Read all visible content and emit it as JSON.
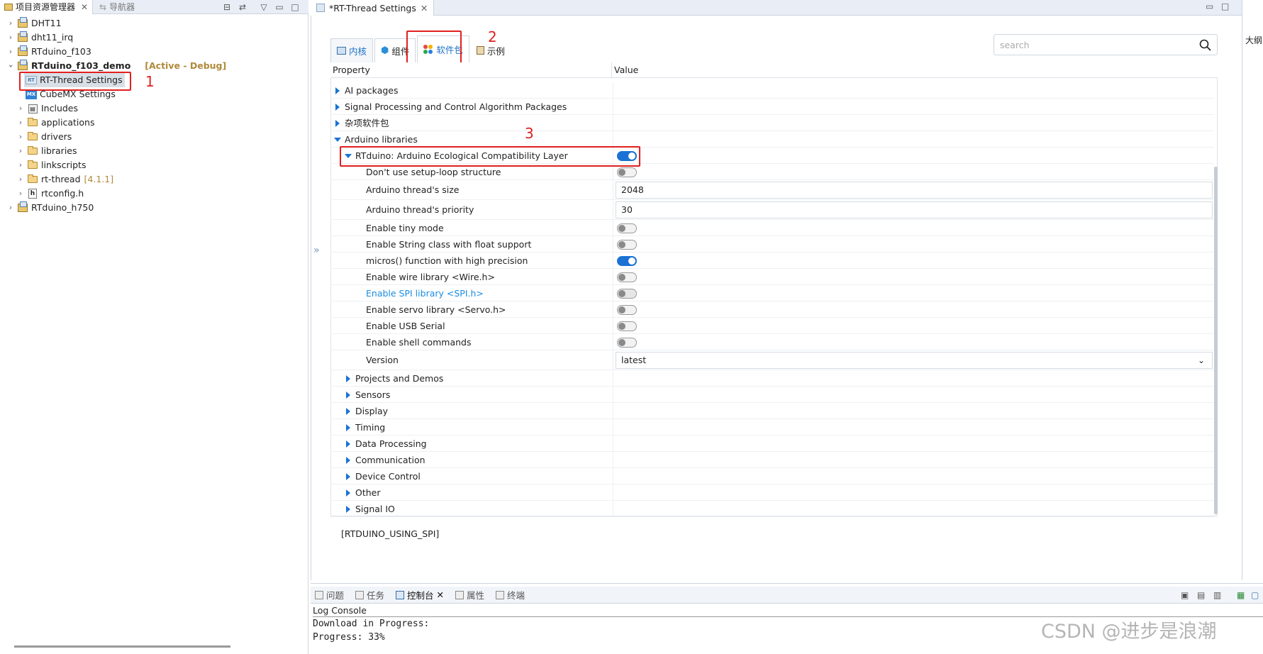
{
  "left_panel": {
    "tab_project_explorer": "项目资源管理器",
    "tab_navigator": "导航器",
    "tree": [
      {
        "label": "DHT11"
      },
      {
        "label": "dht11_irq"
      },
      {
        "label": "RTduino_f103"
      },
      {
        "label": "RTduino_f103_demo",
        "tag": "[Active - Debug]"
      },
      {
        "label": "RT-Thread Settings"
      },
      {
        "label": "CubeMX Settings"
      },
      {
        "label": "Includes"
      },
      {
        "label": "applications"
      },
      {
        "label": "drivers"
      },
      {
        "label": "libraries"
      },
      {
        "label": "linkscripts"
      },
      {
        "label": "rt-thread",
        "tag": "[4.1.1]"
      },
      {
        "label": "rtconfig.h"
      },
      {
        "label": "RTduino_h750"
      }
    ]
  },
  "annotations": {
    "n1": "1",
    "n2": "2",
    "n3": "3"
  },
  "editor": {
    "tab_title": "*RT-Thread Settings",
    "inner_tabs": [
      "内核",
      "组件",
      "软件包",
      "示例"
    ],
    "search_placeholder": "search",
    "columns": {
      "property": "Property",
      "value": "Value"
    },
    "rows": [
      {
        "name": "AI packages"
      },
      {
        "name": "Signal Processing and Control Algorithm Packages"
      },
      {
        "name": "杂项软件包"
      },
      {
        "name": "Arduino libraries"
      },
      {
        "name": "RTduino: Arduino Ecological Compatibility Layer"
      },
      {
        "name": "Don't use setup-loop structure"
      },
      {
        "name": "Arduino thread's size",
        "value": "2048"
      },
      {
        "name": "Arduino thread's priority",
        "value": "30"
      },
      {
        "name": "Enable tiny mode"
      },
      {
        "name": "Enable String class with float support"
      },
      {
        "name": "micros() function with high precision"
      },
      {
        "name": "Enable wire library <Wire.h>"
      },
      {
        "name": "Enable SPI library <SPI.h>"
      },
      {
        "name": "Enable servo library <Servo.h>"
      },
      {
        "name": "Enable USB Serial"
      },
      {
        "name": "Enable shell commands"
      },
      {
        "name": "Version",
        "value": "latest"
      },
      {
        "name": "Projects and Demos"
      },
      {
        "name": "Sensors"
      },
      {
        "name": "Display"
      },
      {
        "name": "Timing"
      },
      {
        "name": "Data Processing"
      },
      {
        "name": "Communication"
      },
      {
        "name": "Device Control"
      },
      {
        "name": "Other"
      },
      {
        "name": "Signal IO"
      }
    ],
    "macro_text": "[RTDUINO_USING_SPI]"
  },
  "right_strip": {
    "text": "大纲"
  },
  "console": {
    "tabs": [
      "问题",
      "任务",
      "控制台",
      "属性",
      "终端"
    ],
    "title": "Log Console",
    "line1": "Download in Progress:",
    "line2": "Progress: 33%"
  },
  "watermark": "CSDN @进步是浪潮",
  "colors": {
    "accent": "#1a73d4",
    "annotation": "#e02020",
    "tag": "#b0893a",
    "link": "#1a8de0"
  }
}
